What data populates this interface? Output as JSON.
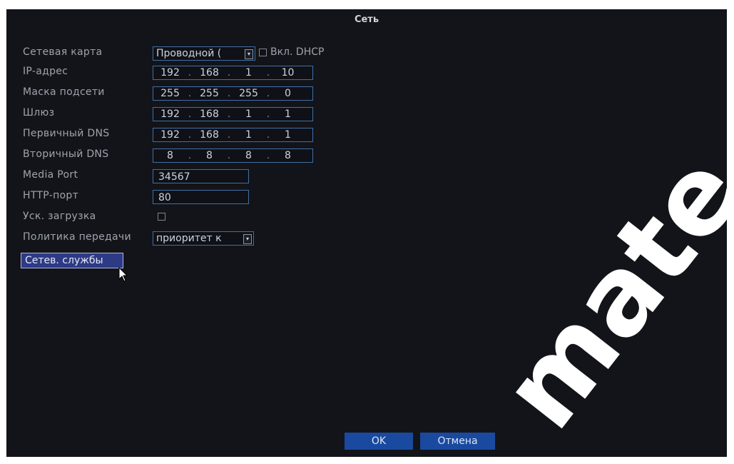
{
  "window": {
    "title": "Сеть"
  },
  "form": {
    "network_card": {
      "label": "Сетевая карта",
      "value": "Проводной (",
      "dhcp_label": "Вкл. DHCP",
      "dhcp_checked": false
    },
    "ip": {
      "label": "IP-адрес",
      "octets": [
        "192",
        "168",
        "1",
        "10"
      ]
    },
    "mask": {
      "label": "Маска подсети",
      "octets": [
        "255",
        "255",
        "255",
        "0"
      ]
    },
    "gateway": {
      "label": "Шлюз",
      "octets": [
        "192",
        "168",
        "1",
        "1"
      ]
    },
    "dns1": {
      "label": "Первичный DNS",
      "octets": [
        "192",
        "168",
        "1",
        "1"
      ]
    },
    "dns2": {
      "label": "Вторичный DNS",
      "octets": [
        "8",
        "8",
        "8",
        "8"
      ]
    },
    "media_port": {
      "label": "Media Port",
      "value": "34567"
    },
    "http_port": {
      "label": "HTTP-порт",
      "value": "80"
    },
    "fast_download": {
      "label": "Уск. загрузка",
      "checked": false
    },
    "transfer_policy": {
      "label": "Политика передачи",
      "value": "приоритет к"
    },
    "net_services_button": "Сетев. службы"
  },
  "footer": {
    "ok_label": "OK",
    "cancel_label": "Отмена"
  },
  "watermark": {
    "text": "mate"
  },
  "colors": {
    "background": "#131419",
    "field_border": "#3f6fa4",
    "button_blue": "#1a4aa0",
    "highlight_button": "#2d3a86",
    "label_text": "#9ea3ad"
  },
  "icons": {
    "dropdown": "chevron-down-icon",
    "pointer": "mouse-pointer-icon"
  }
}
